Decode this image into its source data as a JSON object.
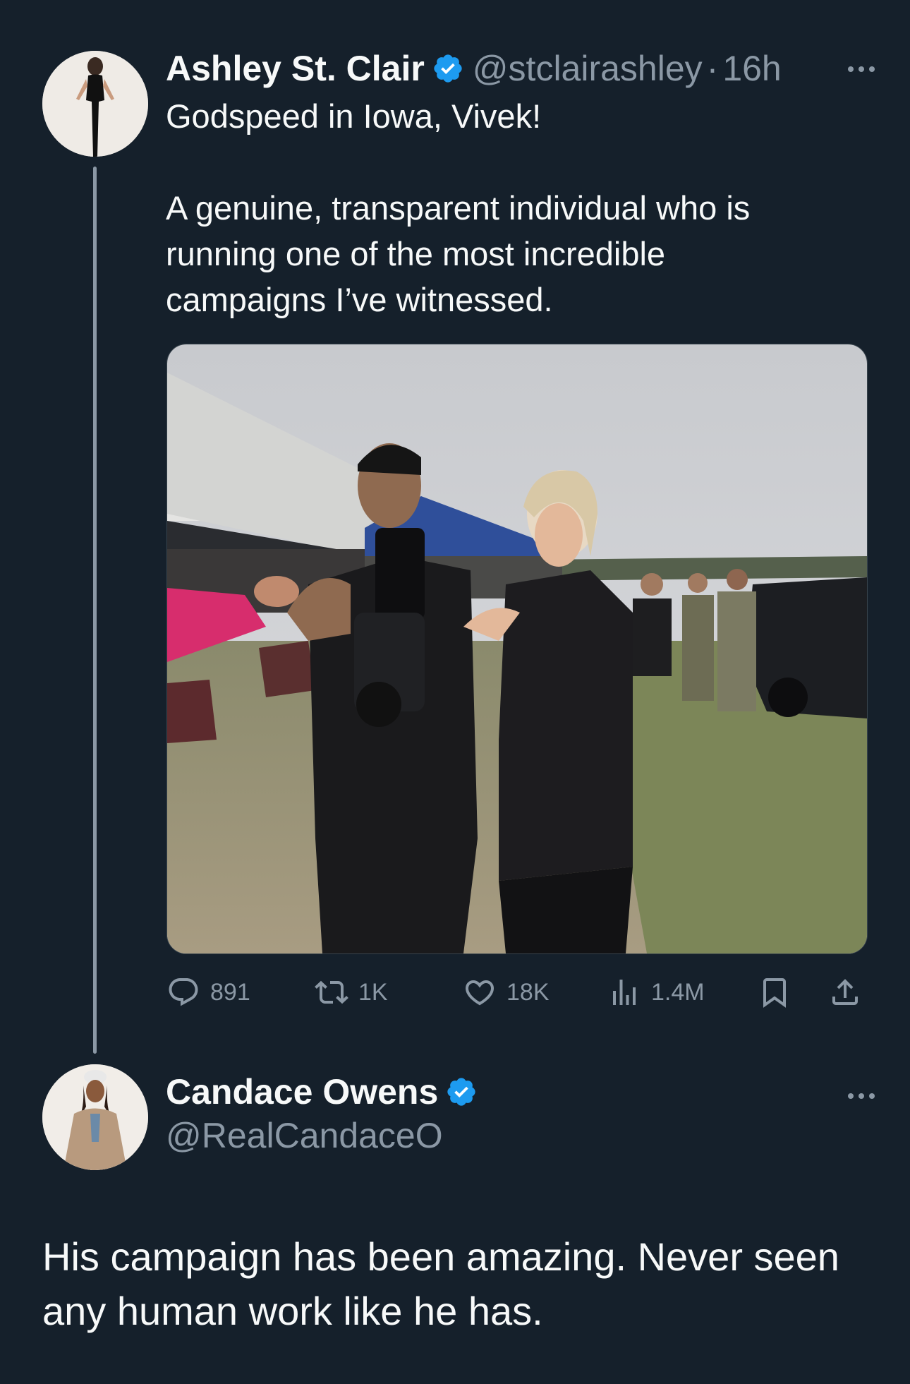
{
  "tweet1": {
    "name": "Ashley St. Clair",
    "handle": "@stclairashley",
    "separator": "·",
    "time": "16h",
    "text_line1": "Godspeed in Iowa, Vivek!",
    "text_para2_l1": "A genuine, transparent individual who is",
    "text_para2_l2": "running one of the most incredible",
    "text_para2_l3": "campaigns I’ve witnessed.",
    "actions": {
      "replies": "891",
      "retweets": "1K",
      "likes": "18K",
      "views": "1.4M"
    }
  },
  "tweet2": {
    "name": "Candace Owens",
    "handle": "@RealCandaceO",
    "text_line1": "His campaign has been amazing. Never seen",
    "text_line2": "any human work like he has."
  },
  "colors": {
    "background": "#15202b",
    "text": "#f7f9f9",
    "muted": "#8b98a5",
    "verified": "#1d9bf0"
  },
  "icons": [
    "verified-badge-icon",
    "more-icon",
    "reply-icon",
    "retweet-icon",
    "like-icon",
    "views-icon",
    "bookmark-icon",
    "share-icon"
  ]
}
